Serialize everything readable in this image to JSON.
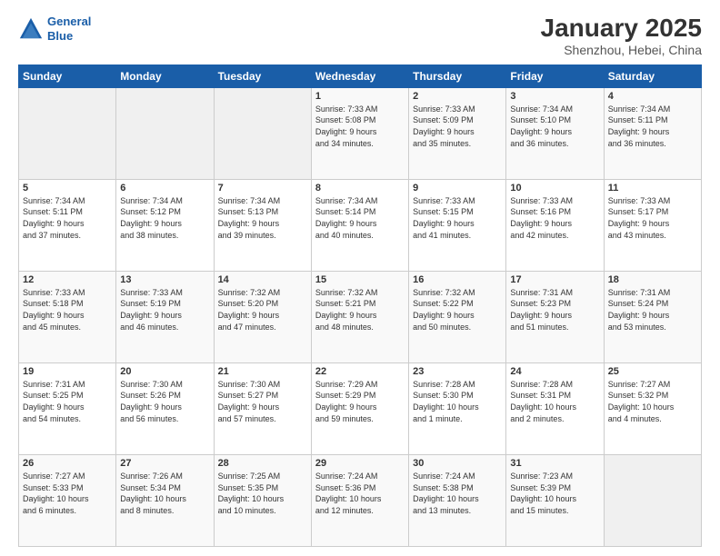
{
  "header": {
    "logo_line1": "General",
    "logo_line2": "Blue",
    "title": "January 2025",
    "subtitle": "Shenzhou, Hebei, China"
  },
  "days_of_week": [
    "Sunday",
    "Monday",
    "Tuesday",
    "Wednesday",
    "Thursday",
    "Friday",
    "Saturday"
  ],
  "weeks": [
    [
      {
        "num": "",
        "info": ""
      },
      {
        "num": "",
        "info": ""
      },
      {
        "num": "",
        "info": ""
      },
      {
        "num": "1",
        "info": "Sunrise: 7:33 AM\nSunset: 5:08 PM\nDaylight: 9 hours\nand 34 minutes."
      },
      {
        "num": "2",
        "info": "Sunrise: 7:33 AM\nSunset: 5:09 PM\nDaylight: 9 hours\nand 35 minutes."
      },
      {
        "num": "3",
        "info": "Sunrise: 7:34 AM\nSunset: 5:10 PM\nDaylight: 9 hours\nand 36 minutes."
      },
      {
        "num": "4",
        "info": "Sunrise: 7:34 AM\nSunset: 5:11 PM\nDaylight: 9 hours\nand 36 minutes."
      }
    ],
    [
      {
        "num": "5",
        "info": "Sunrise: 7:34 AM\nSunset: 5:11 PM\nDaylight: 9 hours\nand 37 minutes."
      },
      {
        "num": "6",
        "info": "Sunrise: 7:34 AM\nSunset: 5:12 PM\nDaylight: 9 hours\nand 38 minutes."
      },
      {
        "num": "7",
        "info": "Sunrise: 7:34 AM\nSunset: 5:13 PM\nDaylight: 9 hours\nand 39 minutes."
      },
      {
        "num": "8",
        "info": "Sunrise: 7:34 AM\nSunset: 5:14 PM\nDaylight: 9 hours\nand 40 minutes."
      },
      {
        "num": "9",
        "info": "Sunrise: 7:33 AM\nSunset: 5:15 PM\nDaylight: 9 hours\nand 41 minutes."
      },
      {
        "num": "10",
        "info": "Sunrise: 7:33 AM\nSunset: 5:16 PM\nDaylight: 9 hours\nand 42 minutes."
      },
      {
        "num": "11",
        "info": "Sunrise: 7:33 AM\nSunset: 5:17 PM\nDaylight: 9 hours\nand 43 minutes."
      }
    ],
    [
      {
        "num": "12",
        "info": "Sunrise: 7:33 AM\nSunset: 5:18 PM\nDaylight: 9 hours\nand 45 minutes."
      },
      {
        "num": "13",
        "info": "Sunrise: 7:33 AM\nSunset: 5:19 PM\nDaylight: 9 hours\nand 46 minutes."
      },
      {
        "num": "14",
        "info": "Sunrise: 7:32 AM\nSunset: 5:20 PM\nDaylight: 9 hours\nand 47 minutes."
      },
      {
        "num": "15",
        "info": "Sunrise: 7:32 AM\nSunset: 5:21 PM\nDaylight: 9 hours\nand 48 minutes."
      },
      {
        "num": "16",
        "info": "Sunrise: 7:32 AM\nSunset: 5:22 PM\nDaylight: 9 hours\nand 50 minutes."
      },
      {
        "num": "17",
        "info": "Sunrise: 7:31 AM\nSunset: 5:23 PM\nDaylight: 9 hours\nand 51 minutes."
      },
      {
        "num": "18",
        "info": "Sunrise: 7:31 AM\nSunset: 5:24 PM\nDaylight: 9 hours\nand 53 minutes."
      }
    ],
    [
      {
        "num": "19",
        "info": "Sunrise: 7:31 AM\nSunset: 5:25 PM\nDaylight: 9 hours\nand 54 minutes."
      },
      {
        "num": "20",
        "info": "Sunrise: 7:30 AM\nSunset: 5:26 PM\nDaylight: 9 hours\nand 56 minutes."
      },
      {
        "num": "21",
        "info": "Sunrise: 7:30 AM\nSunset: 5:27 PM\nDaylight: 9 hours\nand 57 minutes."
      },
      {
        "num": "22",
        "info": "Sunrise: 7:29 AM\nSunset: 5:29 PM\nDaylight: 9 hours\nand 59 minutes."
      },
      {
        "num": "23",
        "info": "Sunrise: 7:28 AM\nSunset: 5:30 PM\nDaylight: 10 hours\nand 1 minute."
      },
      {
        "num": "24",
        "info": "Sunrise: 7:28 AM\nSunset: 5:31 PM\nDaylight: 10 hours\nand 2 minutes."
      },
      {
        "num": "25",
        "info": "Sunrise: 7:27 AM\nSunset: 5:32 PM\nDaylight: 10 hours\nand 4 minutes."
      }
    ],
    [
      {
        "num": "26",
        "info": "Sunrise: 7:27 AM\nSunset: 5:33 PM\nDaylight: 10 hours\nand 6 minutes."
      },
      {
        "num": "27",
        "info": "Sunrise: 7:26 AM\nSunset: 5:34 PM\nDaylight: 10 hours\nand 8 minutes."
      },
      {
        "num": "28",
        "info": "Sunrise: 7:25 AM\nSunset: 5:35 PM\nDaylight: 10 hours\nand 10 minutes."
      },
      {
        "num": "29",
        "info": "Sunrise: 7:24 AM\nSunset: 5:36 PM\nDaylight: 10 hours\nand 12 minutes."
      },
      {
        "num": "30",
        "info": "Sunrise: 7:24 AM\nSunset: 5:38 PM\nDaylight: 10 hours\nand 13 minutes."
      },
      {
        "num": "31",
        "info": "Sunrise: 7:23 AM\nSunset: 5:39 PM\nDaylight: 10 hours\nand 15 minutes."
      },
      {
        "num": "",
        "info": ""
      }
    ]
  ]
}
